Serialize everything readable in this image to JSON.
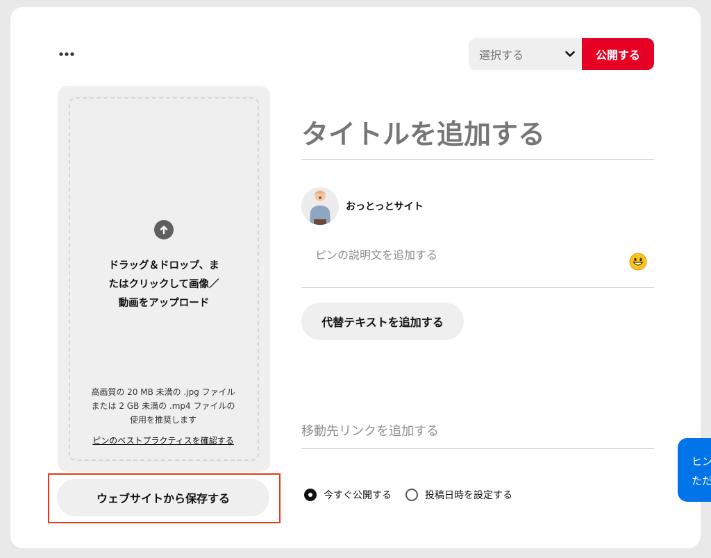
{
  "header": {
    "board_select_label": "選択する",
    "publish_label": "公開する"
  },
  "upload": {
    "drop_text": "ドラッグ＆ドロップ、またはクリックして画像／動画をアップロード",
    "hint_lines": [
      "高画質の 20 MB 未満の .jpg ファイル",
      "または 2 GB 未満の .mp4 ファイルの",
      "使用を推奨します"
    ],
    "practices_link": "ピンのベストプラクティスを確認する",
    "save_from_site_label": "ウェブサイトから保存する"
  },
  "form": {
    "title_placeholder": "タイトルを追加する",
    "user_name": "おっとっとサイト",
    "description_placeholder": "ピンの説明文を追加する",
    "alt_text_label": "代替テキストを追加する",
    "link_placeholder": "移動先リンクを追加する",
    "publish_options": [
      {
        "label": "今すぐ公開する",
        "checked": true
      },
      {
        "label": "投稿日時を設定する",
        "checked": false
      }
    ]
  },
  "help_bubble": {
    "lines": [
      "ヒン",
      "ただ"
    ]
  },
  "colors": {
    "brand_red": "#e60023",
    "help_blue": "#0074e8",
    "highlight": "#e5391a"
  }
}
